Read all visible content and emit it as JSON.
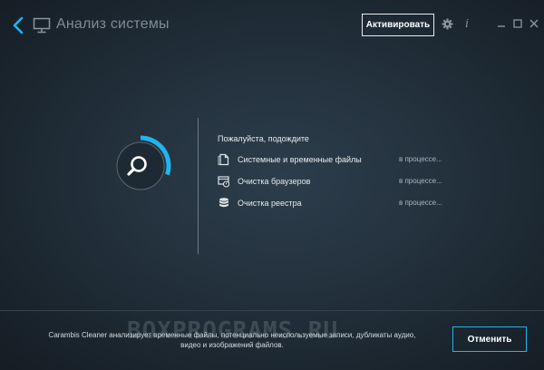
{
  "header": {
    "title": "Анализ системы",
    "activate_label": "Активировать",
    "icons": {
      "back": "back-arrow-icon",
      "monitor": "monitor-icon",
      "settings": "gear-icon",
      "info": "info-icon",
      "minimize": "minimize-icon",
      "maximize": "maximize-icon",
      "close": "close-icon"
    },
    "info_glyph": "i"
  },
  "progress": {
    "icon": "search-icon",
    "arc_fraction": 0.3
  },
  "status": {
    "heading": "Пожалуйста, подождите",
    "tasks": [
      {
        "icon": "file-icon",
        "label": "Системные и временные файлы",
        "status": "в процессе..."
      },
      {
        "icon": "browser-clean-icon",
        "label": "Очистка браузеров",
        "status": "в процессе..."
      },
      {
        "icon": "database-icon",
        "label": "Очистка реестра",
        "status": "в процессе..."
      }
    ]
  },
  "footer": {
    "description": "Carambis Cleaner анализирует временные файлы, потенциально неиспользуемые записи, дубликаты аудио, видео и изображений файлов.",
    "cancel_label": "Отменить",
    "watermark": "BOXPROGRAMS.RU"
  },
  "colors": {
    "accent": "#1fb5ef",
    "title_text": "#7f8c96",
    "background": "#24323e"
  }
}
